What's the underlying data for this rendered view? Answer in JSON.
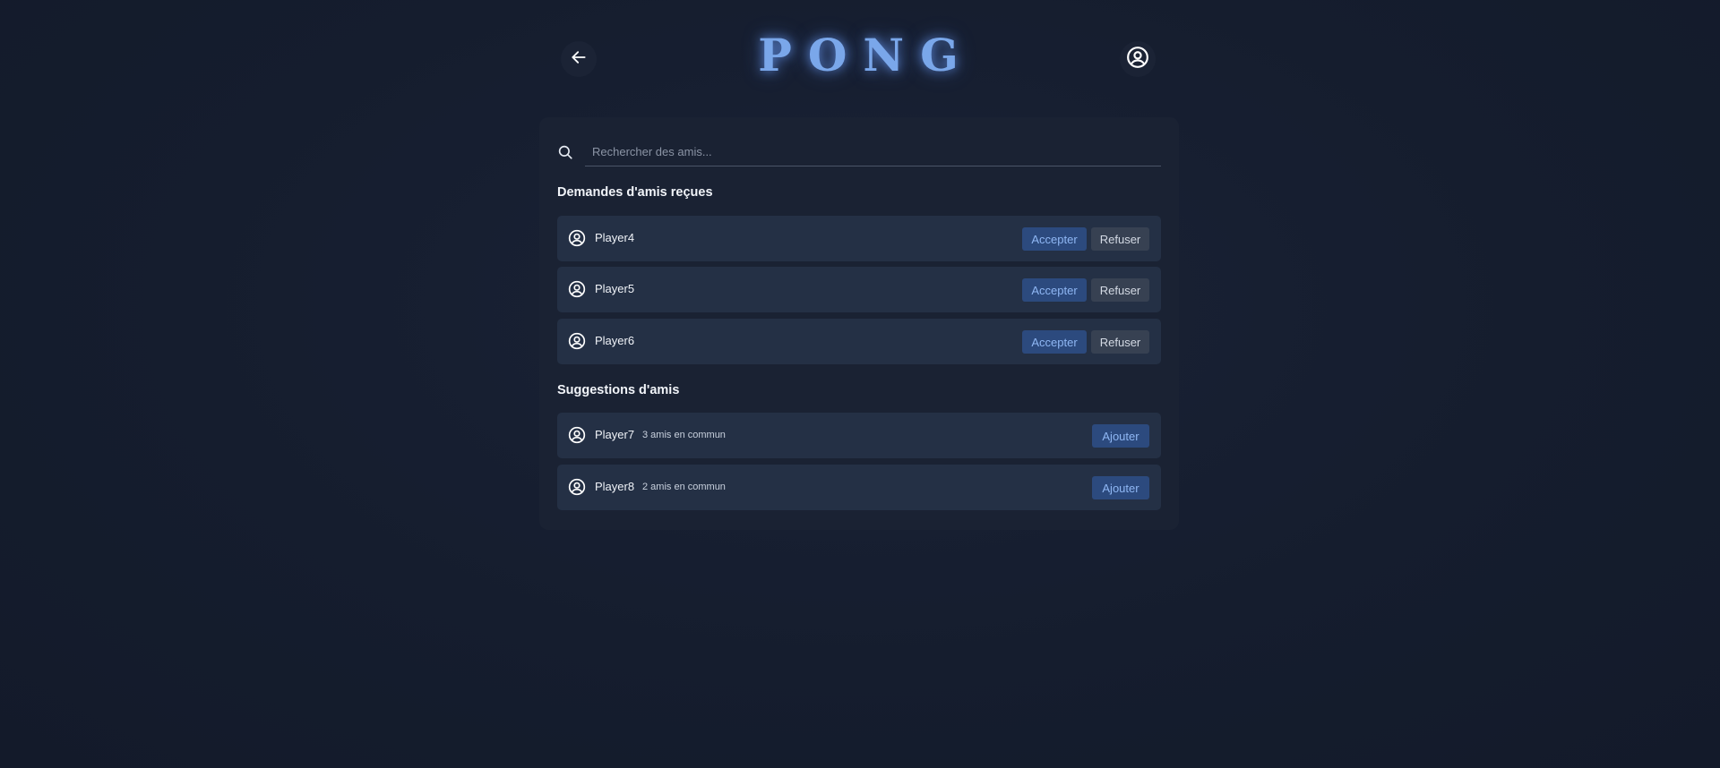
{
  "app": {
    "title": "PONG"
  },
  "header": {
    "back_icon": "arrow-left-icon",
    "profile_icon": "user-circle-icon"
  },
  "search": {
    "placeholder": "Rechercher des amis...",
    "value": "",
    "icon": "search-icon"
  },
  "requests": {
    "title": "Demandes d'amis reçues",
    "accept_label": "Accepter",
    "refuse_label": "Refuser",
    "items": [
      {
        "name": "Player4"
      },
      {
        "name": "Player5"
      },
      {
        "name": "Player6"
      }
    ]
  },
  "suggestions": {
    "title": "Suggestions d'amis",
    "add_label": "Ajouter",
    "items": [
      {
        "name": "Player7",
        "mutual": "3 amis en commun"
      },
      {
        "name": "Player8",
        "mutual": "2 amis en commun"
      }
    ]
  },
  "colors": {
    "accent": "#7aa7ea",
    "background": "#151d2e",
    "panel": "#1a2233",
    "row": "#243045",
    "accept_bg": "#2c4a7e",
    "refuse_bg": "#374152"
  }
}
